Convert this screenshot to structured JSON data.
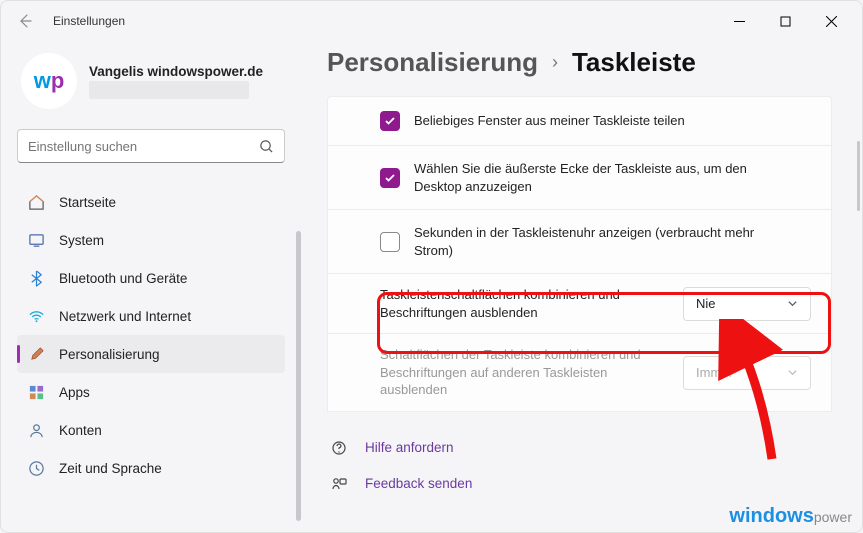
{
  "titlebar": {
    "title": "Einstellungen"
  },
  "profile": {
    "name": "Vangelis windowspower.de"
  },
  "search": {
    "placeholder": "Einstellung suchen"
  },
  "sidebar": {
    "items": [
      {
        "label": "Startseite"
      },
      {
        "label": "System"
      },
      {
        "label": "Bluetooth und Geräte"
      },
      {
        "label": "Netzwerk und Internet"
      },
      {
        "label": "Personalisierung"
      },
      {
        "label": "Apps"
      },
      {
        "label": "Konten"
      },
      {
        "label": "Zeit und Sprache"
      }
    ]
  },
  "breadcrumb": {
    "parent": "Personalisierung",
    "current": "Taskleiste"
  },
  "settings": {
    "row0": "Beliebiges Fenster aus meiner Taskleiste teilen",
    "row1": "Wählen Sie die äußerste Ecke der Taskleiste aus, um den Desktop anzuzeigen",
    "row2": "Sekunden in der Taskleistenuhr anzeigen (verbraucht mehr Strom)",
    "combine": {
      "label": "Taskleistenschaltflächen kombinieren und Beschriftungen ausblenden",
      "value": "Nie"
    },
    "combineOther": {
      "label": "Schaltflächen der Taskleiste kombinieren und Beschriftungen auf anderen Taskleisten ausblenden",
      "value": "Immer"
    }
  },
  "links": {
    "help": "Hilfe anfordern",
    "feedback": "Feedback senden"
  },
  "watermark": {
    "a": "windows",
    "b": "power"
  }
}
